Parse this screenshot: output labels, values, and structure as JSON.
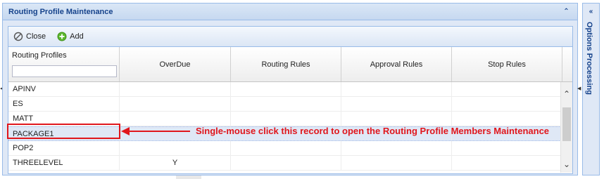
{
  "panel": {
    "title": "Routing Profile Maintenance"
  },
  "toolbar": {
    "close_label": "Close",
    "add_label": "Add"
  },
  "grid": {
    "columns": [
      "Routing Profiles",
      "OverDue",
      "Routing Rules",
      "Approval Rules",
      "Stop Rules"
    ],
    "filter": {
      "value": ""
    },
    "rows": [
      {
        "name": "APINV",
        "overdue": "",
        "routing_rules": "",
        "approval_rules": "",
        "stop_rules": ""
      },
      {
        "name": "ES",
        "overdue": "",
        "routing_rules": "",
        "approval_rules": "",
        "stop_rules": ""
      },
      {
        "name": "MATT",
        "overdue": "",
        "routing_rules": "",
        "approval_rules": "",
        "stop_rules": ""
      },
      {
        "name": "PACKAGE1",
        "overdue": "",
        "routing_rules": "",
        "approval_rules": "",
        "stop_rules": ""
      },
      {
        "name": "POP2",
        "overdue": "",
        "routing_rules": "",
        "approval_rules": "",
        "stop_rules": ""
      },
      {
        "name": "THREELEVEL",
        "overdue": "Y",
        "routing_rules": "",
        "approval_rules": "",
        "stop_rules": ""
      }
    ]
  },
  "annotation": {
    "text": "Single-mouse click this record to open the Routing Profile Members Maintenance",
    "color": "#e0161c"
  },
  "side_panel": {
    "title": "Options Processing"
  },
  "colors": {
    "header_text": "#15428b",
    "border": "#99bbe8",
    "panel_bg": "#dfe8f6",
    "add_icon": "#5cb82d"
  },
  "icons": {
    "close": "circle-slash-icon",
    "add": "plus-circle-icon",
    "collapse": "double-chevron-icon"
  }
}
